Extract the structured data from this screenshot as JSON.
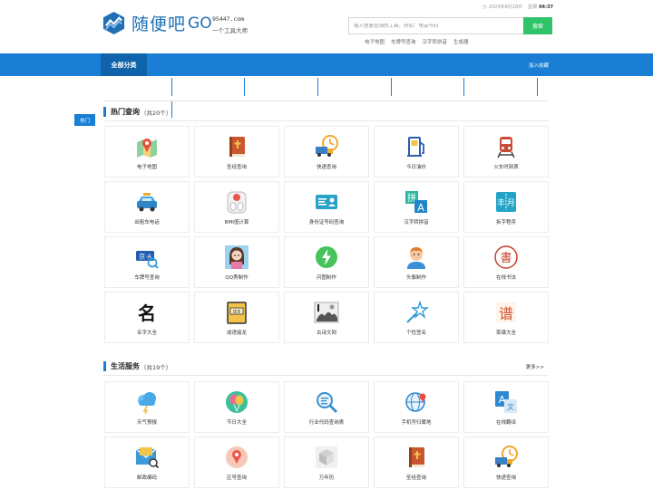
{
  "header": {
    "logo_text": "随便吧",
    "logo_go": "GO",
    "site_domain": "95447.com",
    "site_slogan": "一个工具大师",
    "date_text": "2024年8月28日",
    "weekday": "星期",
    "time_text": "04:37"
  },
  "search": {
    "placeholder": "输入想要查询的工具，例如：电话号码",
    "button_label": "搜索",
    "hot_links": [
      "电子地图",
      "车牌号查询",
      "汉字转拼音",
      "生成器"
    ]
  },
  "nav": {
    "all_categories": "全部分类",
    "add_favorite": "加入收藏"
  },
  "side_tab": "热门",
  "sections": [
    {
      "title": "热门查询",
      "count": "（共20个）",
      "items": [
        {
          "label": "电子地图",
          "icon": "map-pin-icon"
        },
        {
          "label": "圣经查询",
          "icon": "bible-book-icon"
        },
        {
          "label": "快递查询",
          "icon": "delivery-truck-icon"
        },
        {
          "label": "今日油价",
          "icon": "fuel-pump-icon"
        },
        {
          "label": "火车时刻表",
          "icon": "train-icon"
        },
        {
          "label": "出租车电话",
          "icon": "taxi-icon"
        },
        {
          "label": "BMI值计算",
          "icon": "scale-icon"
        },
        {
          "label": "身份证号码查询",
          "icon": "id-card-icon"
        },
        {
          "label": "汉字转拼音",
          "icon": "pinyin-icon"
        },
        {
          "label": "拆字程序",
          "icon": "split-char-icon"
        },
        {
          "label": "车牌号查询",
          "icon": "license-plate-icon"
        },
        {
          "label": "QQ秀制作",
          "icon": "avatar-girl-icon"
        },
        {
          "label": "闪图制作",
          "icon": "lightning-icon"
        },
        {
          "label": "头像制作",
          "icon": "avatar-boy-icon"
        },
        {
          "label": "在线书法",
          "icon": "calligraphy-seal-icon"
        },
        {
          "label": "名字大全",
          "icon": "name-char-icon"
        },
        {
          "label": "成语接龙",
          "icon": "idiom-book-icon"
        },
        {
          "label": "古诗文网",
          "icon": "ink-painting-icon"
        },
        {
          "label": "个性签名",
          "icon": "signature-star-icon"
        },
        {
          "label": "菜谱大全",
          "icon": "recipe-char-icon"
        }
      ]
    },
    {
      "title": "生活服务",
      "count": "（共19个）",
      "more": "更多>>",
      "items": [
        {
          "label": "天气预报",
          "icon": "weather-cloud-icon"
        },
        {
          "label": "节日大全",
          "icon": "balloon-icon"
        },
        {
          "label": "行业代码查询表",
          "icon": "magnifier-code-icon"
        },
        {
          "label": "手机号归属地",
          "icon": "globe-phone-icon"
        },
        {
          "label": "在线翻译",
          "icon": "translate-icon"
        },
        {
          "label": "邮政编码",
          "icon": "mail-envelope-icon"
        },
        {
          "label": "区号查询",
          "icon": "location-pin-icon"
        },
        {
          "label": "万年历",
          "icon": "calendar-cube-icon"
        },
        {
          "label": "圣经查询",
          "icon": "bible-book-icon"
        },
        {
          "label": "快递查询",
          "icon": "delivery-truck-icon"
        }
      ]
    }
  ]
}
